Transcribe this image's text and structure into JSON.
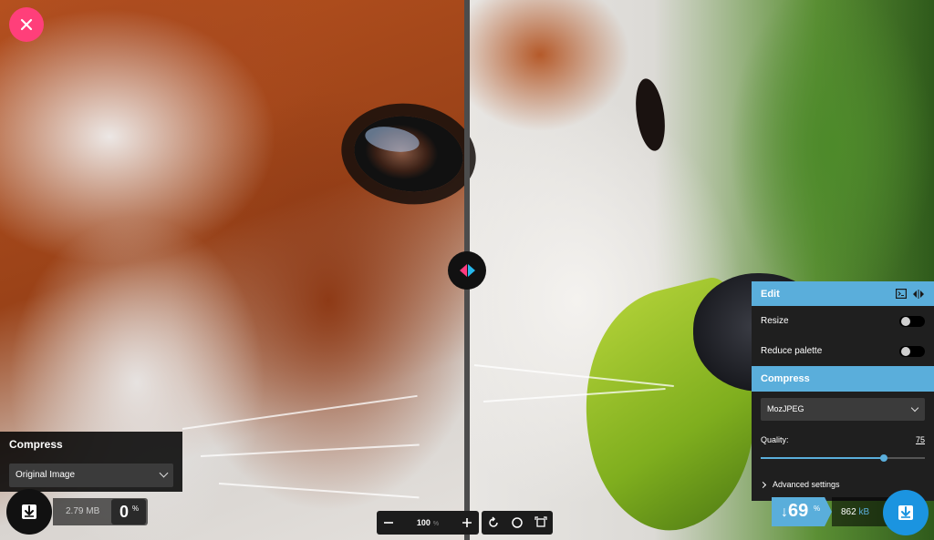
{
  "left_panel": {
    "title": "Compress",
    "format_value": "Original Image",
    "size_value": "2.79",
    "size_unit": "MB",
    "percent": "0",
    "percent_symbol": "%"
  },
  "toolbar": {
    "zoom_value": "100",
    "zoom_unit": "%"
  },
  "right_panel": {
    "edit_title": "Edit",
    "resize_label": "Resize",
    "resize_on": false,
    "reduce_palette_label": "Reduce palette",
    "reduce_palette_on": false,
    "compress_title": "Compress",
    "codec_value": "MozJPEG",
    "quality_label": "Quality:",
    "quality_value": "75",
    "quality_fraction": 0.75,
    "advanced_label": "Advanced settings"
  },
  "result": {
    "arrow": "↓",
    "percent": "69",
    "percent_symbol": "%",
    "size_value": "862",
    "size_unit": "kB"
  },
  "colors": {
    "accent_pink": "#ff3f7a",
    "accent_blue": "#5aaedb",
    "download_blue": "#1b94e0"
  },
  "icons": [
    "close-icon",
    "download-icon",
    "zoom-out-icon",
    "zoom-in-icon",
    "rotate-icon",
    "circle-icon",
    "crop-icon",
    "terminal-icon",
    "split-view-icon",
    "chevron-down-icon",
    "chevron-right-icon"
  ]
}
